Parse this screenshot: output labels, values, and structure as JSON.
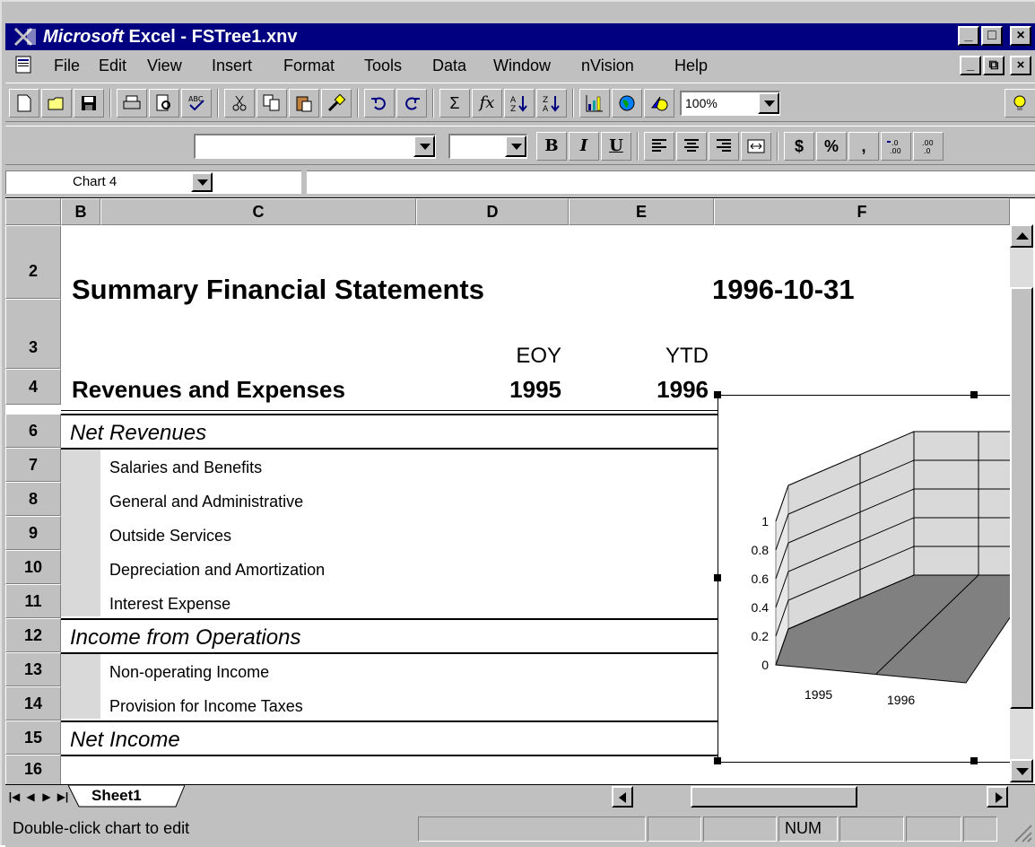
{
  "window": {
    "title_brand": "Microsoft",
    "title_rest": " Excel - FSTree1.xnv",
    "caption_minimize": "_",
    "caption_maximize": "□",
    "caption_close": "×"
  },
  "menu": {
    "items": [
      "File",
      "Edit",
      "View",
      "Insert",
      "Format",
      "Tools",
      "Data",
      "Window",
      "nVision",
      "Help"
    ],
    "mdi_minimize": "_",
    "mdi_restore": "⧉",
    "mdi_close": "×"
  },
  "toolbar": {
    "zoom": "100%",
    "font_name": "",
    "font_size": "",
    "bold": "B",
    "italic": "I",
    "underline": "U",
    "currency": "$",
    "percent": "%",
    "comma": ",",
    "sum": "Σ",
    "fx": "fx"
  },
  "namebox": {
    "value": "Chart 4"
  },
  "columns": [
    "B",
    "C",
    "D",
    "E",
    "F"
  ],
  "rows": [
    "2",
    "3",
    "4",
    "6",
    "7",
    "8",
    "9",
    "10",
    "11",
    "12",
    "13",
    "14",
    "15",
    "16"
  ],
  "sheet": {
    "title": "Summary Financial Statements",
    "date": "1996-10-31",
    "hdr_d_top": "EOY",
    "hdr_e_top": "YTD",
    "section": "Revenues and Expenses",
    "hdr_d_bottom": "1995",
    "hdr_e_bottom": "1996",
    "lines": [
      "Net Revenues",
      "Salaries and Benefits",
      "General and Administrative",
      "Outside Services",
      "Depreciation and Amortization",
      "Interest Expense",
      "Income from Operations",
      "Non-operating Income",
      "Provision for Income Taxes",
      "Net Income"
    ]
  },
  "chart_data": {
    "type": "bar",
    "categories": [
      "1995",
      "1996"
    ],
    "values": [
      0,
      0
    ],
    "yticks": [
      "1",
      "0.8",
      "0.6",
      "0.4",
      "0.2",
      "0"
    ],
    "ylim": [
      0,
      1
    ],
    "grid": true
  },
  "tabs": {
    "active": "Sheet1"
  },
  "status": {
    "message": "Double-click chart to edit",
    "num": "NUM"
  }
}
